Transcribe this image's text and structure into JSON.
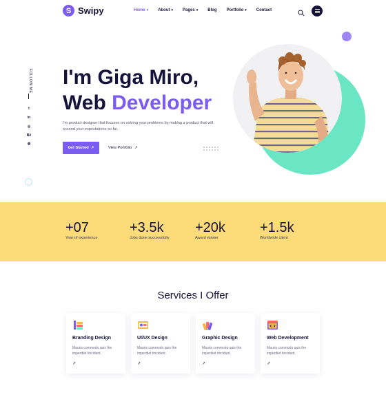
{
  "brand": {
    "name": "Swipy",
    "mark": "S"
  },
  "nav": {
    "items": [
      {
        "label": "Home",
        "has_caret": true,
        "active": true
      },
      {
        "label": "About",
        "has_caret": true,
        "active": false
      },
      {
        "label": "Pages",
        "has_caret": true,
        "active": false
      },
      {
        "label": "Blog",
        "has_caret": false,
        "active": false
      },
      {
        "label": "Portfolio",
        "has_caret": true,
        "active": false
      },
      {
        "label": "Contact",
        "has_caret": false,
        "active": false
      }
    ],
    "search_icon": "search-icon",
    "menu_icon": "hamburger-icon"
  },
  "sidebar": {
    "follow_label": "FOLLOW ME",
    "socials": [
      {
        "icon": "twitter-icon",
        "glyph": "t"
      },
      {
        "icon": "linkedin-icon",
        "glyph": "in"
      },
      {
        "icon": "instagram-icon",
        "glyph": "◎"
      },
      {
        "icon": "behance-icon",
        "glyph": "Bē"
      },
      {
        "icon": "dribbble-icon",
        "glyph": "◍"
      }
    ]
  },
  "hero": {
    "line1": "I'm Giga Miro,",
    "line2_plain": "Web",
    "line2_accent": "Developer",
    "description": "I'm product designer that focuses on solving your problems by making a product that will exceed your expectations so far.",
    "primary_button": "Get Started",
    "secondary_button": "View Portfolio"
  },
  "stats": [
    {
      "value": "+07",
      "label": "Year of experience"
    },
    {
      "value": "+3.5k",
      "label": "Jobs done successfully"
    },
    {
      "value": "+20k",
      "label": "Award winner"
    },
    {
      "value": "+1.5k",
      "label": "Worldwide client"
    }
  ],
  "services": {
    "title": "Services I Offer",
    "cards": [
      {
        "title": "Branding Design",
        "desc": "Mauris commodo quis the imperdiet tincidunt.",
        "icon": "branding-icon"
      },
      {
        "title": "UI/UX Design",
        "desc": "Mauris commodo quis the imperdiet tincidunt.",
        "icon": "uiux-icon"
      },
      {
        "title": "Graphic Design",
        "desc": "Mauris commodo quis the imperdiet tincidunt.",
        "icon": "graphic-icon"
      },
      {
        "title": "Web Development",
        "desc": "Mauris commodo quis the imperdiet tincidunt.",
        "icon": "web-dev-icon"
      }
    ]
  },
  "colors": {
    "accent": "#7c5cf0",
    "dark": "#16133a",
    "teal": "#6be6c4",
    "stats_bg": "#fddb78"
  }
}
